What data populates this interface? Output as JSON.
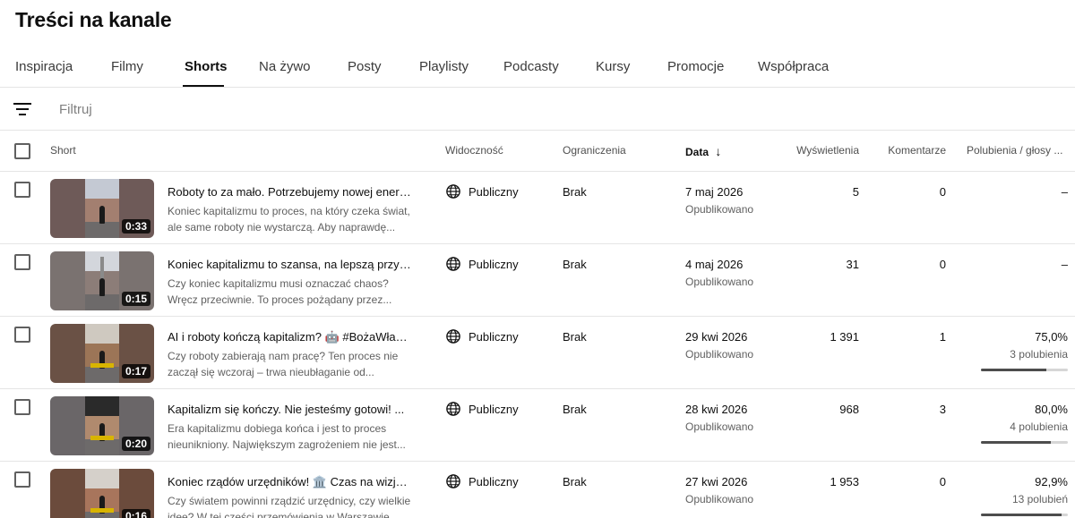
{
  "page": {
    "title": "Treści na kanale"
  },
  "tabs": [
    {
      "label": "Inspiracja"
    },
    {
      "label": "Filmy"
    },
    {
      "label": "Shorts"
    },
    {
      "label": "Na żywo"
    },
    {
      "label": "Posty"
    },
    {
      "label": "Playlisty"
    },
    {
      "label": "Podcasty"
    },
    {
      "label": "Kursy"
    },
    {
      "label": "Promocje"
    },
    {
      "label": "Współpraca"
    }
  ],
  "active_tab": "Shorts",
  "filter": {
    "placeholder": "Filtruj",
    "icon": "filter-icon"
  },
  "columns": {
    "short": "Short",
    "visibility": "Widoczność",
    "restrictions": "Ograniczenia",
    "date": "Data",
    "date_sort": "↓",
    "views": "Wyświetlenia",
    "comments": "Komentarze",
    "likes": "Polubienia / głosy ..."
  },
  "rows": [
    {
      "duration": "0:33",
      "title": "Roboty to za mało. Potrzebujemy nowej energii...",
      "description": "Koniec kapitalizmu to proces, na który czeka świat, ale same roboty nie wystarczą. Aby naprawdę...",
      "visibility": "Publiczny",
      "restrictions": "Brak",
      "date": "7 maj 2026",
      "date_status": "Opublikowano",
      "views": "5",
      "comments": "0",
      "likes": "–",
      "likes_count": "",
      "likes_ratio": null
    },
    {
      "duration": "0:15",
      "title": "Koniec kapitalizmu to szansa, na lepszą przysz...",
      "description": "Czy koniec kapitalizmu musi oznaczać chaos? Wręcz przeciwnie. To proces pożądany przez...",
      "visibility": "Publiczny",
      "restrictions": "Brak",
      "date": "4 maj 2026",
      "date_status": "Opublikowano",
      "views": "31",
      "comments": "0",
      "likes": "–",
      "likes_count": "",
      "likes_ratio": null
    },
    {
      "duration": "0:17",
      "title": "AI i roboty kończą kapitalizm? 🤖 #BożaWładz...",
      "description": "Czy roboty zabierają nam pracę? Ten proces nie zaczął się wczoraj – trwa nieubłaganie od...",
      "visibility": "Publiczny",
      "restrictions": "Brak",
      "date": "29 kwi 2026",
      "date_status": "Opublikowano",
      "views": "1 391",
      "comments": "1",
      "likes": "75,0%",
      "likes_count": "3 polubienia",
      "likes_ratio": 0.75
    },
    {
      "duration": "0:20",
      "title": "Kapitalizm się kończy. Nie jesteśmy gotowi! ...",
      "description": "Era kapitalizmu dobiega końca i jest to proces nieunikniony. Największym zagrożeniem nie jest...",
      "visibility": "Publiczny",
      "restrictions": "Brak",
      "date": "28 kwi 2026",
      "date_status": "Opublikowano",
      "views": "968",
      "comments": "3",
      "likes": "80,0%",
      "likes_count": "4 polubienia",
      "likes_ratio": 0.8
    },
    {
      "duration": "0:16",
      "title": "Koniec rządów urzędników! 🏛️ Czas na wizję. ...",
      "description": "Czy światem powinni rządzić urzędnicy, czy wielkie idee? W tej części przemówienia w Warszawie...",
      "visibility": "Publiczny",
      "restrictions": "Brak",
      "date": "27 kwi 2026",
      "date_status": "Opublikowano",
      "views": "1 953",
      "comments": "0",
      "likes": "92,9%",
      "likes_count": "13 polubień",
      "likes_ratio": 0.929
    }
  ],
  "colors": {
    "bar_fill": "#4d4d4d",
    "bar_track": "#d6d6d6",
    "accent_text": "#0f0f0f",
    "muted_text": "#606060"
  }
}
